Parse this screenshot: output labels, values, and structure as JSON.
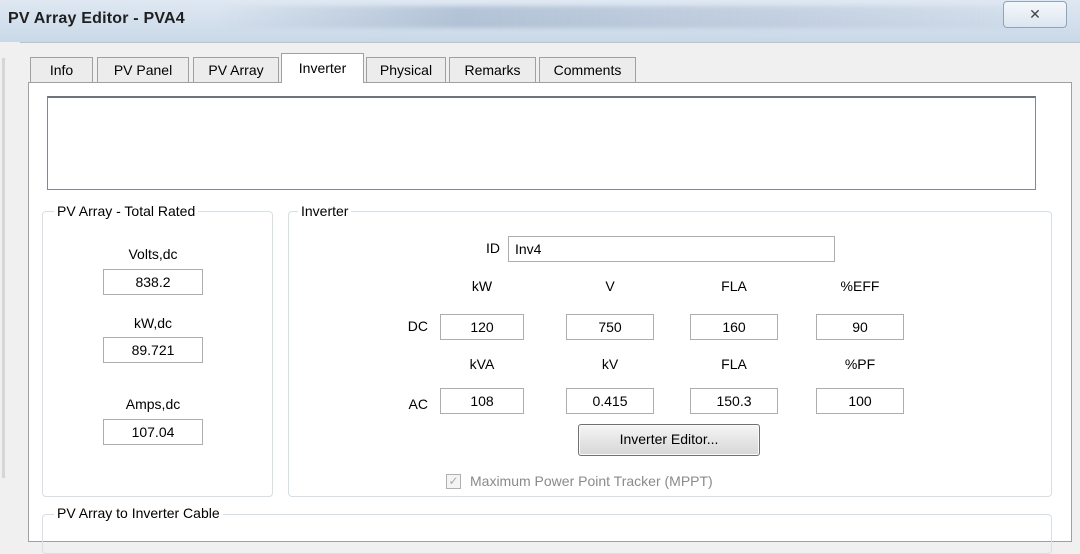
{
  "window": {
    "title": "PV Array Editor - PVA4",
    "close_glyph": "✕"
  },
  "tabs": [
    {
      "label": "Info"
    },
    {
      "label": "PV Panel"
    },
    {
      "label": "PV Array"
    },
    {
      "label": "Inverter",
      "active": true
    },
    {
      "label": "Physical"
    },
    {
      "label": "Remarks"
    },
    {
      "label": "Comments"
    }
  ],
  "notes_box": {
    "value": ""
  },
  "pv_total": {
    "title": "PV Array - Total Rated",
    "volts_label": "Volts,dc",
    "volts_value": "838.2",
    "kw_label": "kW,dc",
    "kw_value": "89.721",
    "amps_label": "Amps,dc",
    "amps_value": "107.04"
  },
  "inverter": {
    "title": "Inverter",
    "id_label": "ID",
    "id_value": "Inv4",
    "dc": {
      "row_label": "DC",
      "headers": [
        "kW",
        "V",
        "FLA",
        "%EFF"
      ],
      "values": [
        "120",
        "750",
        "160",
        "90"
      ]
    },
    "ac": {
      "row_label": "AC",
      "headers": [
        "kVA",
        "kV",
        "FLA",
        "%PF"
      ],
      "values": [
        "108",
        "0.415",
        "150.3",
        "100"
      ]
    },
    "editor_button": "Inverter Editor...",
    "mppt_label": "Maximum Power Point Tracker (MPPT)",
    "mppt_checked": true,
    "check_glyph": "✓"
  },
  "cable": {
    "title": "PV Array to Inverter Cable"
  }
}
